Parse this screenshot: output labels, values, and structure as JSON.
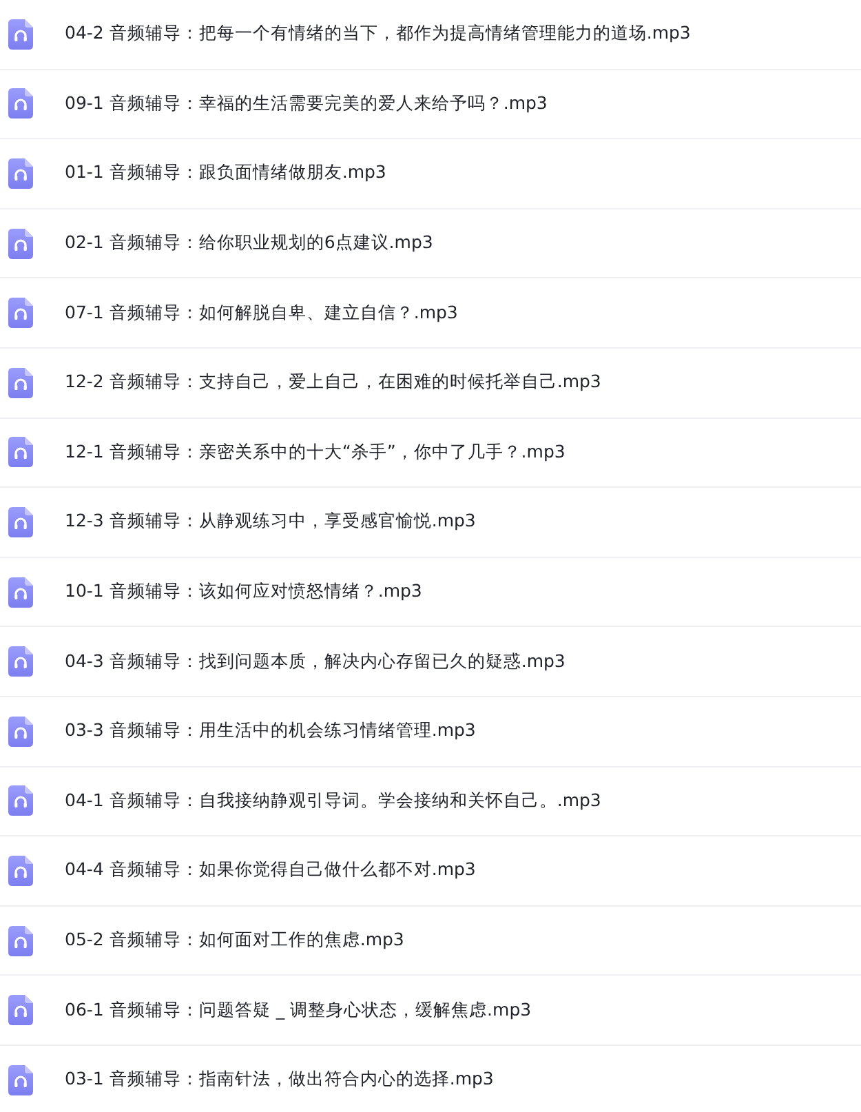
{
  "files": [
    {
      "name": "04-2 音频辅导：把每一个有情绪的当下，都作为提高情绪管理能力的道场.mp3"
    },
    {
      "name": "09-1 音频辅导：幸福的生活需要完美的爱人来给予吗？.mp3"
    },
    {
      "name": "01-1 音频辅导：跟负面情绪做朋友.mp3"
    },
    {
      "name": "02-1 音频辅导：给你职业规划的6点建议.mp3"
    },
    {
      "name": "07-1 音频辅导：如何解脱自卑、建立自信？.mp3"
    },
    {
      "name": "12-2 音频辅导：支持自己，爱上自己，在困难的时候托举自己.mp3"
    },
    {
      "name": "12-1 音频辅导：亲密关系中的十大“杀手”，你中了几手？.mp3"
    },
    {
      "name": "12-3 音频辅导：从静观练习中，享受感官愉悦.mp3"
    },
    {
      "name": "10-1 音频辅导：该如何应对愤怒情绪？.mp3"
    },
    {
      "name": "04-3 音频辅导：找到问题本质，解决内心存留已久的疑惑.mp3"
    },
    {
      "name": "03-3 音频辅导：用生活中的机会练习情绪管理.mp3"
    },
    {
      "name": "04-1 音频辅导：自我接纳静观引导词。学会接纳和关怀自己。.mp3"
    },
    {
      "name": "04-4 音频辅导：如果你觉得自己做什么都不对.mp3"
    },
    {
      "name": "05-2 音频辅导：如何面对工作的焦虑.mp3"
    },
    {
      "name": "06-1 音频辅导：问题答疑 _ 调整身心状态，缓解焦虑.mp3"
    },
    {
      "name": "03-1 音频辅导：指南针法，做出符合内心的选择.mp3"
    }
  ]
}
